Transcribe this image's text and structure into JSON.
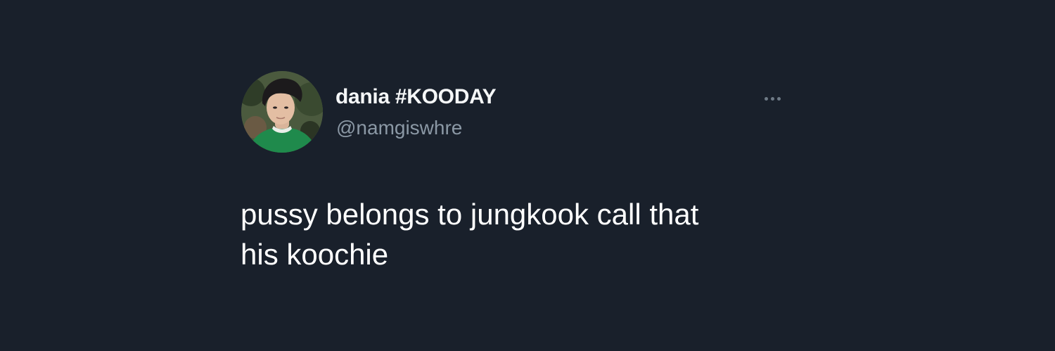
{
  "tweet": {
    "author": {
      "display_name": "dania #KOODAY",
      "handle": "@namgiswhre",
      "avatar_icon": "profile-photo"
    },
    "text": "pussy belongs to jungkook call that\nhis koochie",
    "more_icon": "more-horizontal-icon"
  },
  "colors": {
    "background": "#19202b",
    "primary_text": "#ffffff",
    "secondary_text": "#8b98a5"
  }
}
